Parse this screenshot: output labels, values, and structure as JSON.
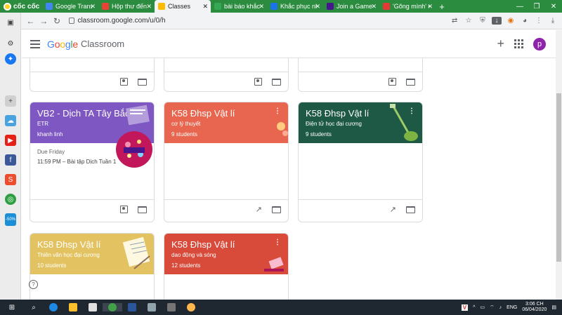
{
  "browser": {
    "brand": "cốc cốc",
    "tabs": [
      {
        "title": "Google Transl",
        "fav": "#4285f4"
      },
      {
        "title": "Hộp thư đến",
        "fav": "#ea4335"
      },
      {
        "title": "Classes",
        "fav": "#fbbc04",
        "active": true
      },
      {
        "title": "bài báo khắc p",
        "fav": "#34a853"
      },
      {
        "title": "Khắc phục nh",
        "fav": "#1a73e8"
      },
      {
        "title": "Join a Game",
        "fav": "#46178f"
      },
      {
        "title": "'Gõng mình' c",
        "fav": "#e53935"
      }
    ],
    "url": "classroom.google.com/u/0/h",
    "win_min": "—",
    "win_max": "❐",
    "win_close": "✕"
  },
  "app": {
    "google": "Google",
    "product": "Classroom",
    "avatar_letter": "p",
    "plus": "+"
  },
  "cards": [
    {
      "name": "VB2 - Dịch TA Tây Bắc",
      "section": "ETR",
      "meta": "khanh linh",
      "color": "#7e57c2",
      "due_label": "Due Friday",
      "due_item": "11:59 PM – Bài tập Dịch Tuần 1",
      "footer": [
        "portrait",
        "folder"
      ]
    },
    {
      "name": "K58 Đhsp Vật lí",
      "section": "cơ lý thuyết",
      "meta": "9 students",
      "color": "#e8664f",
      "footer": [
        "trend",
        "folder"
      ]
    },
    {
      "name": "K58 Đhsp Vật lí",
      "section": "Điện tử học đại cương",
      "meta": "9 students",
      "color": "#1e5945",
      "footer": [
        "trend",
        "folder"
      ]
    },
    {
      "name": "K58 Đhsp Vật lí",
      "section": "Thiên văn học đại cương",
      "meta": "10 students",
      "color": "#e3c361"
    },
    {
      "name": "K58 Đhsp Vật lí",
      "section": "dao động và sóng",
      "meta": "12 students",
      "color": "#d84a3a"
    }
  ],
  "help_label": "?",
  "taskbar": {
    "lang": "ENG",
    "time": "3:06 CH",
    "date": "06/04/2020"
  }
}
